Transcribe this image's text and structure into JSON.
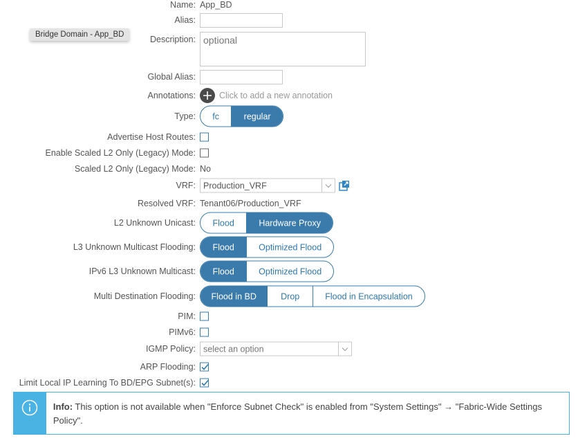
{
  "tooltip": "Bridge Domain - App_BD",
  "name": {
    "label": "Name:",
    "value": "App_BD"
  },
  "alias": {
    "label": "Alias:",
    "value": ""
  },
  "description": {
    "label": "Description:",
    "placeholder": "optional"
  },
  "global_alias": {
    "label": "Global Alias:",
    "value": ""
  },
  "annotations": {
    "label": "Annotations:",
    "hint": "Click to add a new annotation"
  },
  "type": {
    "label": "Type:",
    "options": [
      "fc",
      "regular"
    ],
    "selected": "regular"
  },
  "advertise_host_routes": {
    "label": "Advertise Host Routes:",
    "checked": false
  },
  "enable_scaled_l2": {
    "label": "Enable Scaled L2 Only (Legacy) Mode:",
    "checked": false
  },
  "scaled_l2": {
    "label": "Scaled L2 Only (Legacy) Mode:",
    "value": "No"
  },
  "vrf": {
    "label": "VRF:",
    "value": "Production_VRF"
  },
  "resolved_vrf": {
    "label": "Resolved VRF:",
    "value": "Tenant06/Production_VRF"
  },
  "l2_unknown_unicast": {
    "label": "L2 Unknown Unicast:",
    "options": [
      "Flood",
      "Hardware Proxy"
    ],
    "selected": "Hardware Proxy"
  },
  "l3_unknown_multicast": {
    "label": "L3 Unknown Multicast Flooding:",
    "options": [
      "Flood",
      "Optimized Flood"
    ],
    "selected": "Flood"
  },
  "ipv6_l3_unknown_multicast": {
    "label": "IPv6 L3 Unknown Multicast:",
    "options": [
      "Flood",
      "Optimized Flood"
    ],
    "selected": "Flood"
  },
  "multi_dest_flooding": {
    "label": "Multi Destination Flooding:",
    "options": [
      "Flood in BD",
      "Drop",
      "Flood in Encapsulation"
    ],
    "selected": "Flood in BD"
  },
  "pim": {
    "label": "PIM:",
    "checked": false
  },
  "pimv6": {
    "label": "PIMv6:",
    "checked": false
  },
  "igmp_policy": {
    "label": "IGMP Policy:",
    "placeholder": "select an option"
  },
  "arp_flooding": {
    "label": "ARP Flooding:",
    "checked": true
  },
  "limit_local_ip": {
    "label": "Limit Local IP Learning To BD/EPG Subnet(s):",
    "checked": true
  },
  "info": {
    "prefix": "Info:",
    "text": " This option is not available when \"Enforce Subnet Check\" is enabled from \"System Settings\" → \"Fabric-Wide Settings Policy\"."
  },
  "colors": {
    "accent": "#3a7bab",
    "info": "#4ab3e3"
  }
}
